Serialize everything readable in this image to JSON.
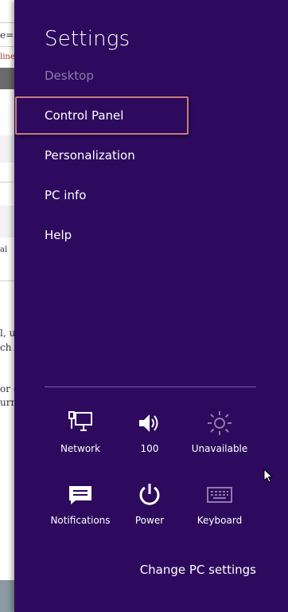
{
  "background_page": {
    "fragments": [
      "e=",
      "line",
      "al",
      "l, u",
      "ch",
      "or (",
      "urn"
    ]
  },
  "settings": {
    "title": "Settings",
    "subtitle": "Desktop",
    "menu": [
      {
        "label": "Control Panel"
      },
      {
        "label": "Personalization"
      },
      {
        "label": "PC info"
      },
      {
        "label": "Help"
      }
    ],
    "quick_settings": [
      {
        "label": "Network",
        "icon": "network-icon"
      },
      {
        "label": "100",
        "icon": "volume-icon"
      },
      {
        "label": "Unavailable",
        "icon": "brightness-icon"
      },
      {
        "label": "Notifications",
        "icon": "notifications-icon"
      },
      {
        "label": "Power",
        "icon": "power-icon"
      },
      {
        "label": "Keyboard",
        "icon": "keyboard-icon"
      }
    ],
    "change_pc_settings": "Change PC settings"
  },
  "colors": {
    "panel": "#2d0a5e",
    "highlight_border": "#c77a7e",
    "dim_text": "#8e7ba8"
  }
}
